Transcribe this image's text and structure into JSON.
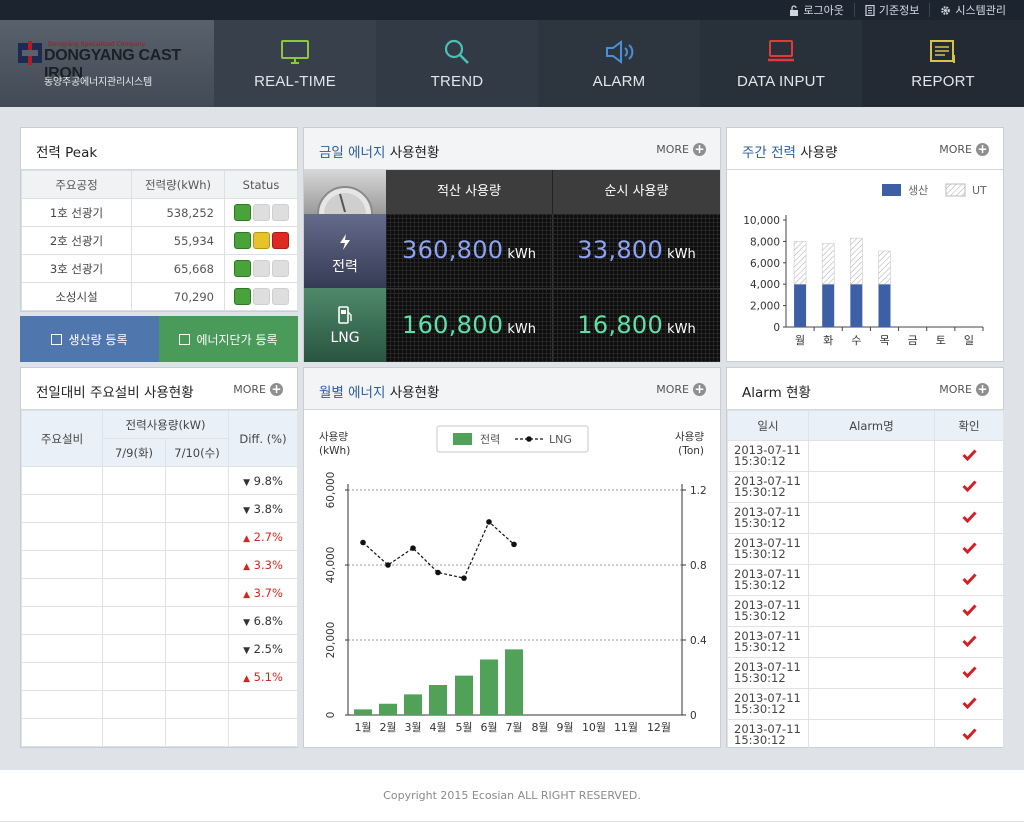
{
  "top_links": [
    {
      "label": "로그아웃",
      "icon": "lock-icon"
    },
    {
      "label": "기준정보",
      "icon": "document-icon"
    },
    {
      "label": "시스템관리",
      "icon": "gear-icon"
    }
  ],
  "brand": {
    "name": "DONGYANG CAST IRON",
    "tagline": "Dongyang Specialized Company",
    "system_name": "동양주공에너지관리시스템"
  },
  "nav": [
    {
      "label": "REAL-TIME",
      "icon": "monitor-icon",
      "color": "#8dc63f"
    },
    {
      "label": "TREND",
      "icon": "search-icon",
      "color": "#49c1b6"
    },
    {
      "label": "ALARM",
      "icon": "speaker-icon",
      "color": "#4d8fd6"
    },
    {
      "label": "DATA INPUT",
      "icon": "laptop-icon",
      "color": "#e03a3e"
    },
    {
      "label": "REPORT",
      "icon": "report-icon",
      "color": "#d7c24a"
    }
  ],
  "more_label": "MORE",
  "peak": {
    "title": "전력 Peak",
    "headers": [
      "주요공정",
      "전력량(kWh)",
      "Status"
    ],
    "rows": [
      {
        "name": "1호 선광기",
        "value": "538,252",
        "lamps": [
          "g",
          "o",
          "o"
        ]
      },
      {
        "name": "2호 선광기",
        "value": "55,934",
        "lamps": [
          "g",
          "y",
          "r"
        ]
      },
      {
        "name": "3호 선광기",
        "value": "65,668",
        "lamps": [
          "g",
          "o",
          "o"
        ]
      },
      {
        "name": "소성시설",
        "value": "70,290",
        "lamps": [
          "g",
          "o",
          "o"
        ]
      }
    ]
  },
  "buttons": {
    "production": "생산량 등록",
    "unit_price": "에너지단가 등록"
  },
  "today_energy": {
    "title_hl": "금일 에너지",
    "title_rest": "사용현황",
    "col_total": "적산 사용량",
    "col_instant": "순시 사용량",
    "rows": [
      {
        "label": "전력",
        "total": "360,800",
        "instant": "33,800",
        "unit": "kWh",
        "color": "#8ea3f3"
      },
      {
        "label": "LNG",
        "total": "160,800",
        "instant": "16,800",
        "unit": "kWh",
        "color": "#5fe0a8"
      }
    ]
  },
  "weekly": {
    "title_hl": "주간 전력",
    "title_rest": "사용량",
    "legend": [
      "생산",
      "UT"
    ],
    "y_ticks": [
      "10,000",
      "8,000",
      "6,000",
      "4,000",
      "2,000",
      "0"
    ]
  },
  "weekly_chart": {
    "type": "bar",
    "categories": [
      "월",
      "화",
      "수",
      "목",
      "금",
      "토",
      "일"
    ],
    "series": [
      {
        "name": "생산",
        "values": [
          4000,
          4000,
          4000,
          4000,
          0,
          0,
          0
        ]
      },
      {
        "name": "UT",
        "values": [
          4000,
          3800,
          4300,
          3100,
          0,
          0,
          0
        ]
      }
    ],
    "ylim": [
      0,
      10000
    ]
  },
  "comparison": {
    "title_hl": "전일대비 주요설비",
    "title_rest": "사용현황",
    "h_equipment": "주요설비",
    "h_usage": "전력사용량(kW)",
    "h_day1": "7/9(화)",
    "h_day2": "7/10(수)",
    "h_diff": "Diff. (%)",
    "diffs": [
      {
        "dir": "down",
        "arrow": "▼",
        "value": "9.8%"
      },
      {
        "dir": "down",
        "arrow": "▼",
        "value": "3.8%"
      },
      {
        "dir": "up",
        "arrow": "▲",
        "value": "2.7%"
      },
      {
        "dir": "up",
        "arrow": "▲",
        "value": "3.3%"
      },
      {
        "dir": "up",
        "arrow": "▲",
        "value": "3.7%"
      },
      {
        "dir": "down",
        "arrow": "▼",
        "value": "6.8%"
      },
      {
        "dir": "down",
        "arrow": "▼",
        "value": "2.5%"
      },
      {
        "dir": "up",
        "arrow": "▲",
        "value": "5.1%"
      },
      {
        "dir": "",
        "arrow": "",
        "value": ""
      },
      {
        "dir": "",
        "arrow": "",
        "value": ""
      }
    ]
  },
  "monthly": {
    "title_hl": "월별 에너지",
    "title_rest": "사용현황",
    "y_left": "사용량",
    "y_left_unit": "(kWh)",
    "y_right": "사용량",
    "y_right_unit": "(Ton)",
    "legend_power": "전력",
    "legend_lng": "LNG",
    "left_ticks": [
      "60,000",
      "40,000",
      "20,000",
      "0"
    ],
    "right_ticks": [
      "1.2",
      "0.8",
      "0.4",
      "0"
    ]
  },
  "chart_data": {
    "type": "bar",
    "categories": [
      "1월",
      "2월",
      "3월",
      "4월",
      "5월",
      "6월",
      "7월",
      "8월",
      "9월",
      "10월",
      "11월",
      "12월"
    ],
    "series": [
      {
        "name": "전력",
        "type": "bar",
        "axis": "left",
        "values": [
          1500,
          3000,
          5500,
          8000,
          10500,
          14800,
          17500,
          null,
          null,
          null,
          null,
          null
        ]
      },
      {
        "name": "LNG",
        "type": "line",
        "axis": "right",
        "values": [
          0.92,
          0.8,
          0.89,
          0.76,
          0.73,
          1.03,
          0.91,
          null,
          null,
          null,
          null,
          null
        ]
      }
    ],
    "ylim": [
      0,
      60000
    ],
    "y2lim": [
      0,
      1.2
    ]
  },
  "alarm": {
    "title_hl": "Alarm",
    "title_rest": "현황",
    "headers": [
      "일시",
      "Alarm명",
      "확인"
    ],
    "rows": [
      {
        "date": "2013-07-11",
        "time": "15:30:12"
      },
      {
        "date": "2013-07-11",
        "time": "15:30:12"
      },
      {
        "date": "2013-07-11",
        "time": "15:30:12"
      },
      {
        "date": "2013-07-11",
        "time": "15:30:12"
      },
      {
        "date": "2013-07-11",
        "time": "15:30:12"
      },
      {
        "date": "2013-07-11",
        "time": "15:30:12"
      },
      {
        "date": "2013-07-11",
        "time": "15:30:12"
      },
      {
        "date": "2013-07-11",
        "time": "15:30:12"
      },
      {
        "date": "2013-07-11",
        "time": "15:30:12"
      },
      {
        "date": "2013-07-11",
        "time": "15:30:12"
      }
    ]
  },
  "footer": "Copyright 2015  Ecosian ALL RIGHT RESERVED."
}
